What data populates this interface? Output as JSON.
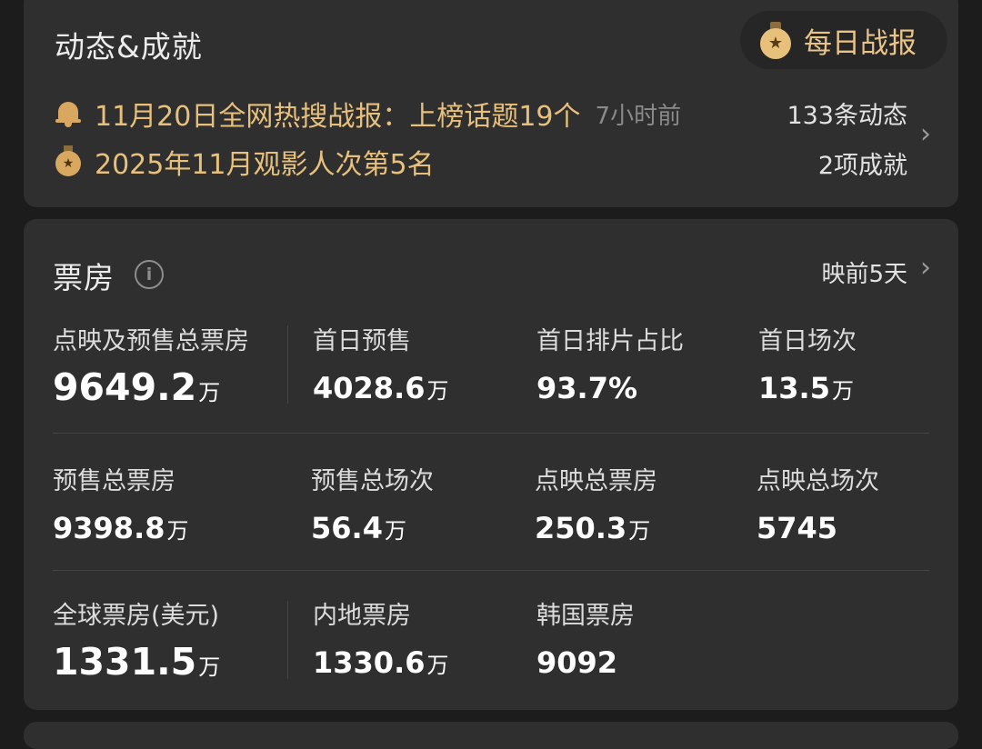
{
  "dynamics": {
    "title": "动态&成就",
    "daily_report_label": "每日战报",
    "news_1": "11月20日全网热搜战报：上榜话题19个",
    "news_1_time": "7小时前",
    "news_2": "2025年11月观影人次第5名",
    "updates_count": "133条动态",
    "achievements_count": "2项成就"
  },
  "boxoffice": {
    "title": "票房",
    "release_status": "映前5天",
    "unit": "万",
    "row1": [
      {
        "label": "点映及预售总票房",
        "value": "9649.2"
      },
      {
        "label": "首日预售",
        "value": "4028.6"
      },
      {
        "label": "首日排片占比",
        "value": "93.7%"
      },
      {
        "label": "首日场次",
        "value": "13.5"
      }
    ],
    "row2": [
      {
        "label": "预售总票房",
        "value": "9398.8"
      },
      {
        "label": "预售总场次",
        "value": "56.4"
      },
      {
        "label": "点映总票房",
        "value": "250.3"
      },
      {
        "label": "点映总场次",
        "value": "5745"
      }
    ],
    "row3": [
      {
        "label": "全球票房(美元)",
        "value": "1331.5"
      },
      {
        "label": "内地票房",
        "value": "1330.6"
      },
      {
        "label": "韩国票房",
        "value": "9092"
      }
    ]
  },
  "icons": {
    "bell": "bell-icon",
    "medal": "medal-icon",
    "info": "info-icon",
    "chevron": "chevron-right-icon"
  },
  "colors": {
    "accent_gold": "#e7c07c",
    "card_bg": "#2f2f2f",
    "page_bg": "#1c1c1c"
  }
}
